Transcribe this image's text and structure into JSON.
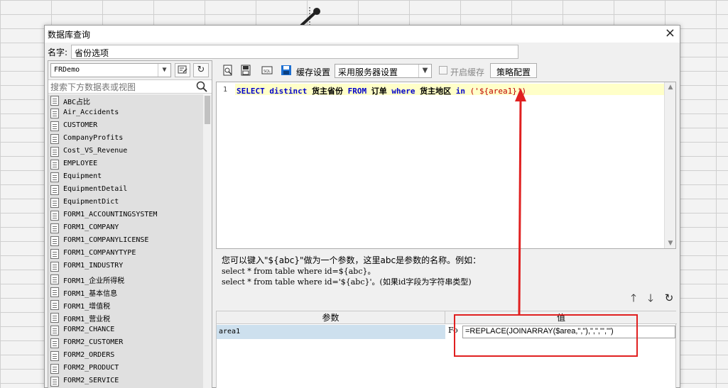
{
  "dialog": {
    "title": "数据库查询",
    "close": "×",
    "name_label": "名字:",
    "name_value": "省份选项"
  },
  "datasource": {
    "selected": "FRDemo",
    "search_placeholder": "搜索下方数据表或视图"
  },
  "tables": [
    "ABC占比",
    "Air_Accidents",
    "CUSTOMER",
    "CompanyProfits",
    "Cost_VS_Revenue",
    "EMPLOYEE",
    "Equipment",
    "EquipmentDetail",
    "EquipmentDict",
    "FORM1_ACCOUNTINGSYSTEM",
    "FORM1_COMPANY",
    "FORM1_COMPANYLICENSE",
    "FORM1_COMPANYTYPE",
    "FORM1_INDUSTRY",
    "FORM1_企业所得税",
    "FORM1_基本信息",
    "FORM1_增值税",
    "FORM1_营业税",
    "FORM2_CHANCE",
    "FORM2_CUSTOMER",
    "FORM2_ORDERS",
    "FORM2_PRODUCT",
    "FORM2_SERVICE"
  ],
  "toolbar": {
    "cache_settings": "缓存设置",
    "cache_mode": "采用服务器设置",
    "enable_cache": "开启缓存",
    "strategy": "策略配置"
  },
  "editor": {
    "line_no": "1",
    "tokens": {
      "k_select": "SELECT",
      "k_distinct": "distinct",
      "col": "货主省份",
      "k_from": "FROM",
      "table": "订单",
      "k_where": "where",
      "col2": "货主地区",
      "k_in": "in",
      "arg": "('${area1}')"
    }
  },
  "hint": {
    "line1": "您可以键入\"${abc}\"做为一个参数，这里abc是参数的名称。例如：",
    "line2": "select * from table where id=${abc}。",
    "line3": "select * from table where id='${abc}'。(如果id字段为字符串类型)"
  },
  "params": {
    "col_param": "参数",
    "col_value": "值",
    "rows": [
      {
        "name": "area1",
        "formula_label": "Fo",
        "value": "=REPLACE(JOINARRAY($area,\",\"),\",\",\"','\")"
      }
    ]
  },
  "colors": {
    "annotation": "#e02020",
    "keyword": "#0000cc",
    "string": "#c00000",
    "highlight_line": "#ffffc8",
    "selected_row": "#cde0ee"
  }
}
